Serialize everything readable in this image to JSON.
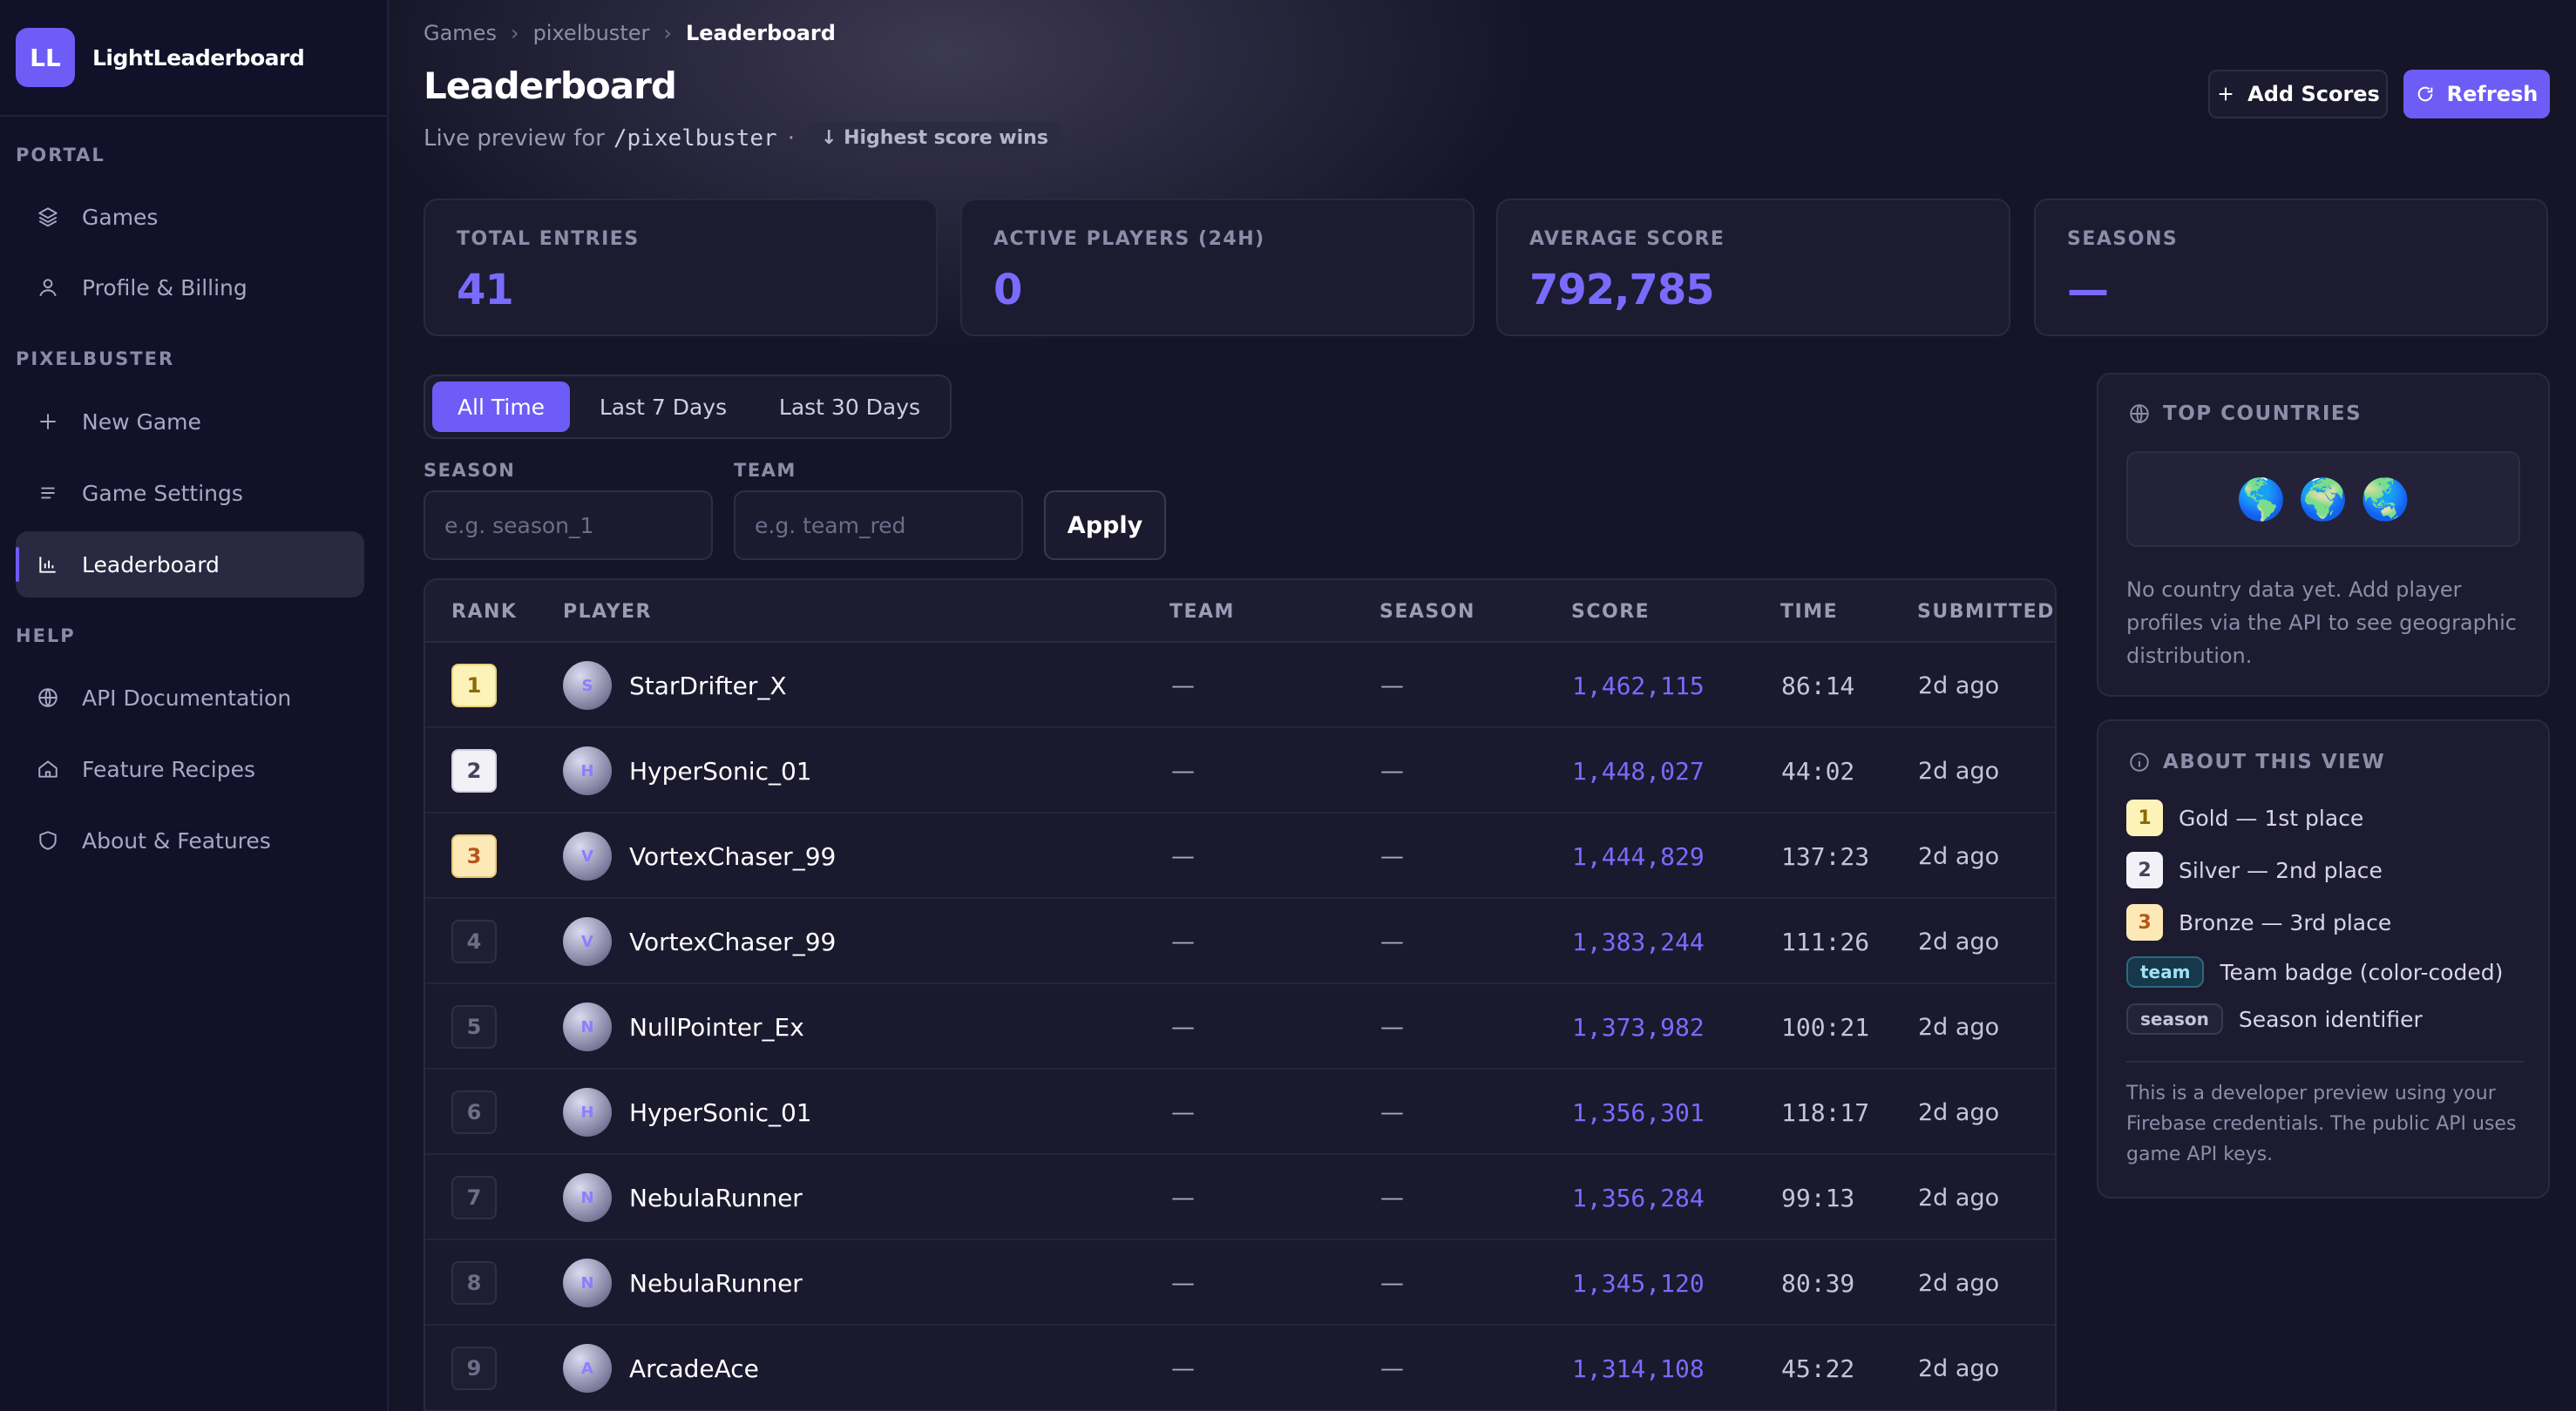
{
  "brand": {
    "initials": "LL",
    "name": "LightLeaderboard"
  },
  "sidebar": {
    "sections": [
      {
        "label": "PORTAL"
      },
      {
        "label": "PIXELBUSTER"
      },
      {
        "label": "HELP"
      }
    ],
    "items": [
      {
        "label": "Games",
        "icon": "layers-icon"
      },
      {
        "label": "Profile & Billing",
        "icon": "user-icon"
      },
      {
        "label": "New Game",
        "icon": "plus-icon"
      },
      {
        "label": "Game Settings",
        "icon": "list-icon"
      },
      {
        "label": "Leaderboard",
        "icon": "bar-chart-icon",
        "active": true
      },
      {
        "label": "API Documentation",
        "icon": "globe-icon"
      },
      {
        "label": "Feature Recipes",
        "icon": "home-icon"
      },
      {
        "label": "About & Features",
        "icon": "shield-icon"
      }
    ]
  },
  "breadcrumb": [
    "Games",
    "pixelbuster",
    "Leaderboard"
  ],
  "page": {
    "title": "Leaderboard",
    "subtitle_prefix": "Live preview for",
    "path": "/pixelbuster",
    "dot": "·",
    "sort_pill": "↓ Highest score wins"
  },
  "actions": {
    "add_scores": "Add Scores",
    "refresh": "Refresh"
  },
  "stats": [
    {
      "label": "TOTAL ENTRIES",
      "value": "41"
    },
    {
      "label": "ACTIVE PLAYERS (24H)",
      "value": "0"
    },
    {
      "label": "AVERAGE SCORE",
      "value": "792,785"
    },
    {
      "label": "SEASONS",
      "value": "—"
    }
  ],
  "tabs": [
    {
      "label": "All Time",
      "active": true
    },
    {
      "label": "Last 7 Days"
    },
    {
      "label": "Last 30 Days"
    }
  ],
  "filters": {
    "season": {
      "label": "SEASON",
      "placeholder": "e.g. season_1",
      "value": ""
    },
    "team": {
      "label": "TEAM",
      "placeholder": "e.g. team_red",
      "value": ""
    },
    "apply": "Apply"
  },
  "table": {
    "headers": [
      "RANK",
      "PLAYER",
      "TEAM",
      "SEASON",
      "SCORE",
      "TIME",
      "SUBMITTED"
    ],
    "rows": [
      {
        "rank": "1",
        "initial": "S",
        "player": "StarDrifter_X",
        "team": "—",
        "season": "—",
        "score": "1,462,115",
        "time": "86:14",
        "submitted": "2d ago"
      },
      {
        "rank": "2",
        "initial": "H",
        "player": "HyperSonic_01",
        "team": "—",
        "season": "—",
        "score": "1,448,027",
        "time": "44:02",
        "submitted": "2d ago"
      },
      {
        "rank": "3",
        "initial": "V",
        "player": "VortexChaser_99",
        "team": "—",
        "season": "—",
        "score": "1,444,829",
        "time": "137:23",
        "submitted": "2d ago"
      },
      {
        "rank": "4",
        "initial": "V",
        "player": "VortexChaser_99",
        "team": "—",
        "season": "—",
        "score": "1,383,244",
        "time": "111:26",
        "submitted": "2d ago"
      },
      {
        "rank": "5",
        "initial": "N",
        "player": "NullPointer_Ex",
        "team": "—",
        "season": "—",
        "score": "1,373,982",
        "time": "100:21",
        "submitted": "2d ago"
      },
      {
        "rank": "6",
        "initial": "H",
        "player": "HyperSonic_01",
        "team": "—",
        "season": "—",
        "score": "1,356,301",
        "time": "118:17",
        "submitted": "2d ago"
      },
      {
        "rank": "7",
        "initial": "N",
        "player": "NebulaRunner",
        "team": "—",
        "season": "—",
        "score": "1,356,284",
        "time": "99:13",
        "submitted": "2d ago"
      },
      {
        "rank": "8",
        "initial": "N",
        "player": "NebulaRunner",
        "team": "—",
        "season": "—",
        "score": "1,345,120",
        "time": "80:39",
        "submitted": "2d ago"
      },
      {
        "rank": "9",
        "initial": "A",
        "player": "ArcadeAce",
        "team": "—",
        "season": "—",
        "score": "1,314,108",
        "time": "45:22",
        "submitted": "2d ago"
      }
    ]
  },
  "top_countries": {
    "title": "TOP COUNTRIES",
    "globes": [
      "🌎",
      "🌍",
      "🌏"
    ],
    "note": "No country data yet. Add player profiles via the API to see geographic distribution."
  },
  "about": {
    "title": "ABOUT THIS VIEW",
    "legend": [
      {
        "badge": "1",
        "text": "Gold — 1st place"
      },
      {
        "badge": "2",
        "text": "Silver — 2nd place"
      },
      {
        "badge": "3",
        "text": "Bronze — 3rd place"
      },
      {
        "tag": "team",
        "text": "Team badge (color-coded)"
      },
      {
        "tag": "season",
        "text": "Season identifier"
      }
    ],
    "note": "This is a developer preview using your Firebase credentials. The public API uses game API keys."
  },
  "colors": {
    "accent": "#6D5CF6",
    "score": "#7A6BFF",
    "gold": "#FDF2B8",
    "silver": "#F1F1F6",
    "bronze": "#FCE9B5"
  }
}
